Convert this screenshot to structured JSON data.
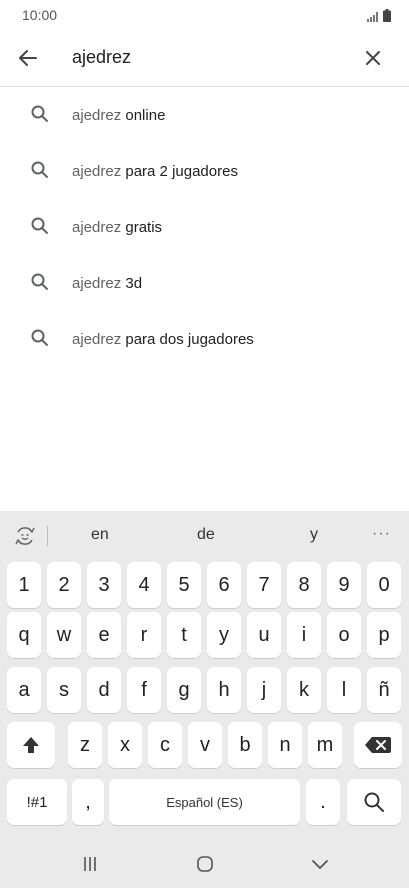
{
  "status_bar": {
    "time": "10:00",
    "icons": [
      "signal-icon",
      "battery-icon"
    ]
  },
  "search": {
    "query": "ajedrez"
  },
  "suggestions": [
    {
      "prefix": "ajedrez",
      "rest": " online"
    },
    {
      "prefix": "ajedrez",
      "rest": " para 2 jugadores"
    },
    {
      "prefix": "ajedrez",
      "rest": " gratis"
    },
    {
      "prefix": "ajedrez",
      "rest": " 3d"
    },
    {
      "prefix": "ajedrez",
      "rest": " para dos jugadores"
    }
  ],
  "keyboard": {
    "word_suggestions": [
      "en",
      "de",
      "y"
    ],
    "more": "···",
    "row_numbers": [
      "1",
      "2",
      "3",
      "4",
      "5",
      "6",
      "7",
      "8",
      "9",
      "0"
    ],
    "row1": [
      "q",
      "w",
      "e",
      "r",
      "t",
      "y",
      "u",
      "i",
      "o",
      "p"
    ],
    "row2": [
      "a",
      "s",
      "d",
      "f",
      "g",
      "h",
      "j",
      "k",
      "l",
      "ñ"
    ],
    "row3": [
      "z",
      "x",
      "c",
      "v",
      "b",
      "n",
      "m"
    ],
    "symbols_key": "!#1",
    "comma_key": ",",
    "space_label": "Español (ES)",
    "period_key": "."
  },
  "colors": {
    "keyboard_bg": "#eaeaea",
    "key_bg": "#ffffff",
    "suggestion_prefix": "#5f6368"
  }
}
